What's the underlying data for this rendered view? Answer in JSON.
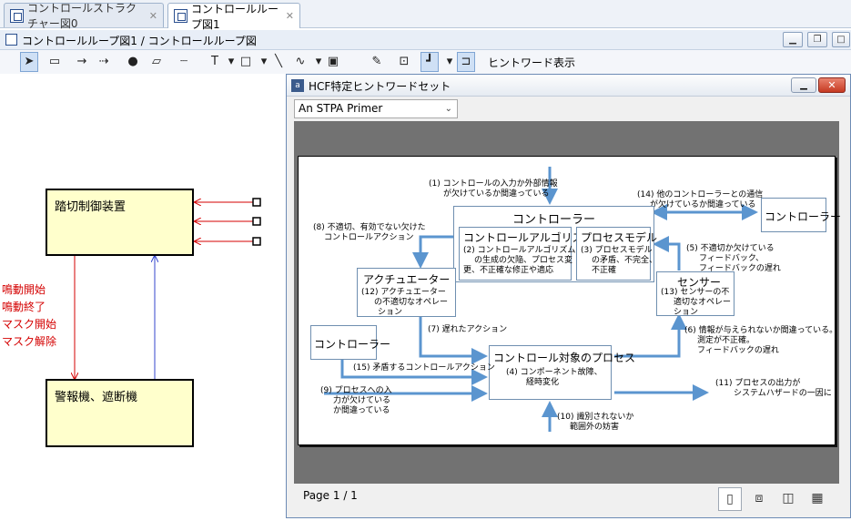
{
  "tabs": [
    {
      "label": "コントロールストラクチャー図0",
      "active": false
    },
    {
      "label": "コントロールループ図1",
      "active": true
    }
  ],
  "editor": {
    "title": "コントロールループ図1 / コントロールループ図"
  },
  "toolbar": {
    "hint_display_label": "ヒントワード表示"
  },
  "canvas": {
    "block_controller": "踏切制御装置",
    "block_actuator": "警報機、遮断機",
    "actions": [
      "鳴動開始",
      "鳴動終了",
      "マスク開始",
      "マスク解除"
    ]
  },
  "hint_window": {
    "title": "HCF特定ヒントワードセット",
    "selected_primer": "An STPA Primer",
    "page_indicator": "Page 1 / 1"
  },
  "diagram": {
    "controller": "コントローラー",
    "control_algorithm": "コントロールアルゴリズム",
    "process_model": "プロセスモデル",
    "actuator": "アクチュエーター",
    "sensor": "センサー",
    "controlled_process": "コントロール対象のプロセス",
    "other_controller": "コントローラー",
    "left_controller": "コントローラー",
    "notes": {
      "n1": [
        "(1) コントロールの入力か外部情報",
        "が欠けているか間違っている"
      ],
      "n2": [
        "(2) コントロールアルゴリズム",
        "の生成の欠陥、プロセス変",
        "更、不正確な修正や適応"
      ],
      "n3": [
        "(3) プロセスモデル",
        "の矛盾、不完全、",
        "不正確"
      ],
      "n4": [
        "(4) コンポーネント故障、",
        "経時変化"
      ],
      "n5": [
        "(5) 不適切か欠けている",
        "フィードバック、",
        "フィードバックの遅れ"
      ],
      "n6": [
        "(6) 情報が与えられないか間違っている。",
        "測定が不正確。",
        "フィードバックの遅れ"
      ],
      "n7": [
        "(7) 遅れたアクション"
      ],
      "n8": [
        "(8) 不適切、有効でない欠けた",
        "コントロールアクション"
      ],
      "n9": [
        "(9) プロセスへの入",
        "力が欠けている",
        "か間違っている"
      ],
      "n10": [
        "(10) 識別されないか",
        "範囲外の妨害"
      ],
      "n11": [
        "(11) プロセスの出力が",
        "システムハザードの一因に"
      ],
      "n12": [
        "(12) アクチュエーター",
        "の不適切なオペレー",
        "ション"
      ],
      "n13": [
        "(13) センサーの不",
        "適切なオペレー",
        "ション"
      ],
      "n14": [
        "(14) 他のコントローラーとの通信",
        "が欠けているか間違っている"
      ],
      "n15": [
        "(15) 矛盾するコントロールアクション"
      ]
    }
  },
  "colors": {
    "arrow_blue": "#5b95cf",
    "red": "#d40000",
    "block_fill": "#ffffcc"
  }
}
